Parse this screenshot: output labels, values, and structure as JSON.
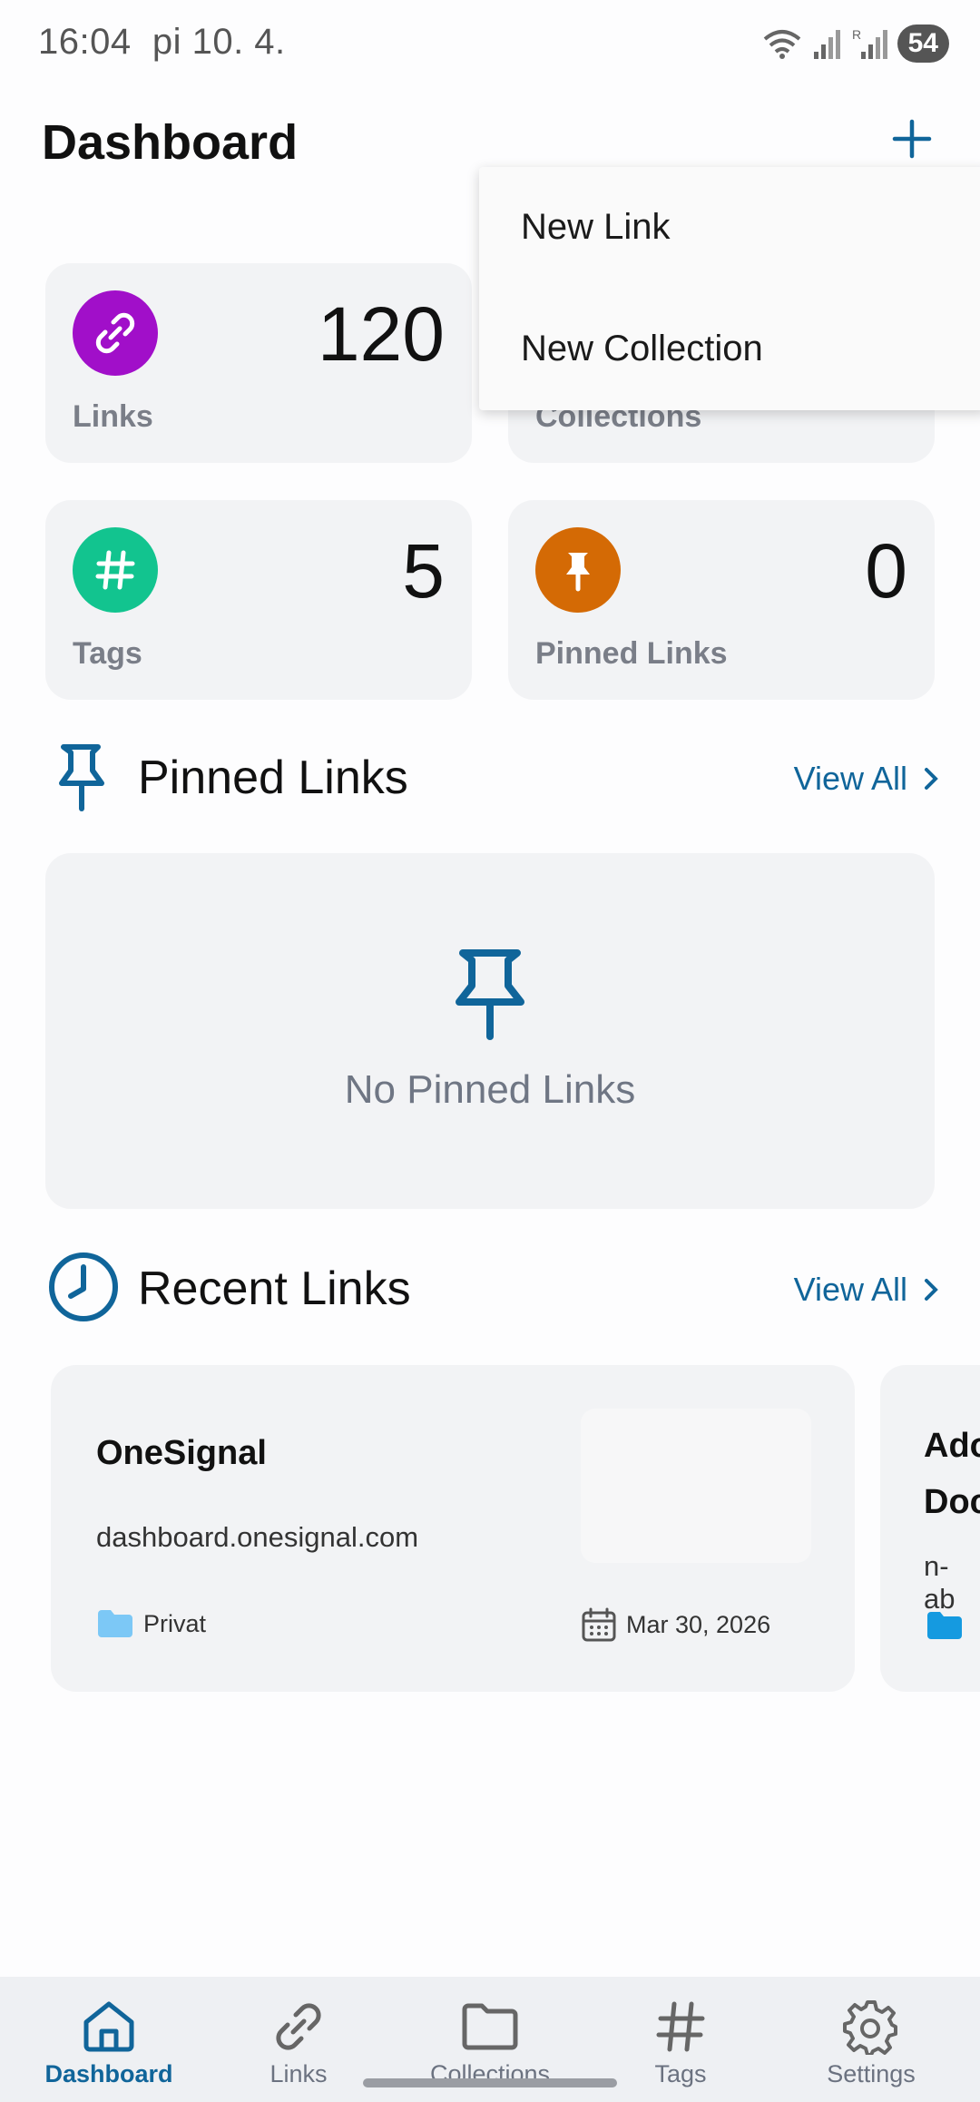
{
  "status_bar": {
    "time": "16:04",
    "date": "pi 10. 4.",
    "battery": "54"
  },
  "header": {
    "title": "Dashboard"
  },
  "menu": {
    "items": [
      {
        "label": "New Link"
      },
      {
        "label": "New Collection"
      }
    ]
  },
  "stats": [
    {
      "label": "Links",
      "value": "120",
      "icon": "link-icon",
      "color": "#a10fc9"
    },
    {
      "label": "Collections",
      "value": "",
      "icon": "folder-icon",
      "color": "#0f7bbf"
    },
    {
      "label": "Tags",
      "value": "5",
      "icon": "hashtag-icon",
      "color": "#12c48f"
    },
    {
      "label": "Pinned Links",
      "value": "0",
      "icon": "pin-icon",
      "color": "#d46a05"
    }
  ],
  "pinned": {
    "title": "Pinned Links",
    "view_all": "View All",
    "empty_text": "No Pinned Links"
  },
  "recent": {
    "title": "Recent Links",
    "view_all": "View All",
    "links": [
      {
        "title": "OneSignal",
        "url": "dashboard.onesignal.com",
        "collection": "Privat",
        "date": "Mar 30, 2026"
      },
      {
        "title": "Ado",
        "title_line2": "Doc",
        "url": "n-ab"
      }
    ]
  },
  "nav": [
    {
      "label": "Dashboard",
      "icon": "home-icon",
      "active": true
    },
    {
      "label": "Links",
      "icon": "link-icon",
      "active": false
    },
    {
      "label": "Collections",
      "icon": "folder-icon",
      "active": false
    },
    {
      "label": "Tags",
      "icon": "hashtag-icon",
      "active": false
    },
    {
      "label": "Settings",
      "icon": "gear-icon",
      "active": false
    }
  ],
  "colors": {
    "accent": "#10659a",
    "card": "#f2f3f5"
  }
}
